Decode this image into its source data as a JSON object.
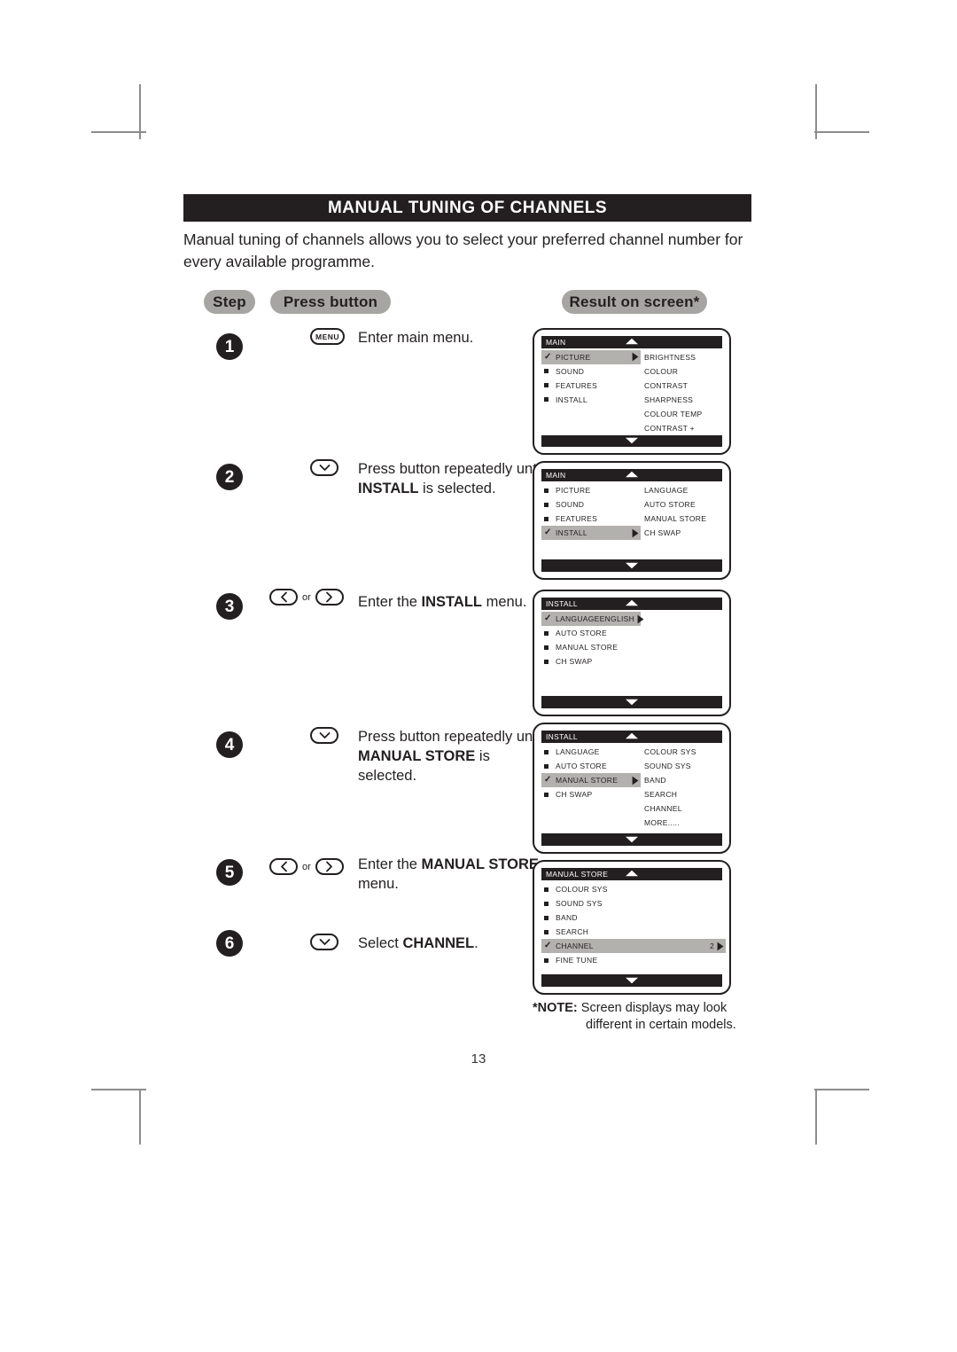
{
  "page": {
    "title": "MANUAL TUNING OF CHANNELS",
    "intro": "Manual tuning of channels allows you to select your preferred channel number for every available programme.",
    "page_number": "13",
    "note_label": "*NOTE:",
    "note_line1": "Screen displays may look",
    "note_line2": "different in certain models.",
    "accent_dark": "#231f20",
    "accent_pill": "#a7a5a2",
    "accent_highlight": "#b3b1ae"
  },
  "columns": {
    "step": "Step",
    "press_button": "Press button",
    "result": "Result on screen*"
  },
  "steps": [
    {
      "number": "1",
      "keys": [
        {
          "type": "menu",
          "label": "MENU"
        }
      ],
      "or_label": "",
      "text_parts": [
        {
          "t": "Enter main menu.",
          "bold": false
        }
      ]
    },
    {
      "number": "2",
      "keys": [
        {
          "type": "down",
          "label": "down-arrow"
        }
      ],
      "or_label": "",
      "text_parts": [
        {
          "t": "Press button repeatedly until ",
          "bold": false
        },
        {
          "t": "INSTALL",
          "bold": true
        },
        {
          "t": " is selected.",
          "bold": false
        }
      ]
    },
    {
      "number": "3",
      "keys": [
        {
          "type": "left",
          "label": "left-arrow"
        },
        {
          "type": "right",
          "label": "right-arrow"
        }
      ],
      "or_label": "or",
      "text_parts": [
        {
          "t": "Enter the ",
          "bold": false
        },
        {
          "t": "INSTALL",
          "bold": true
        },
        {
          "t": " menu.",
          "bold": false
        }
      ]
    },
    {
      "number": "4",
      "keys": [
        {
          "type": "down",
          "label": "down-arrow"
        }
      ],
      "or_label": "",
      "text_parts": [
        {
          "t": "Press button repeatedly until ",
          "bold": false
        },
        {
          "t": "MANUAL STORE",
          "bold": true
        },
        {
          "t": " is selected.",
          "bold": false
        }
      ]
    },
    {
      "number": "5",
      "keys": [
        {
          "type": "left",
          "label": "left-arrow"
        },
        {
          "type": "right",
          "label": "right-arrow"
        }
      ],
      "or_label": "or",
      "text_parts": [
        {
          "t": "Enter the ",
          "bold": false
        },
        {
          "t": "MANUAL STORE",
          "bold": true
        },
        {
          "t": " menu.",
          "bold": false
        }
      ]
    },
    {
      "number": "6",
      "keys": [
        {
          "type": "down",
          "label": "down-arrow"
        }
      ],
      "or_label": "",
      "text_parts": [
        {
          "t": "Select ",
          "bold": false
        },
        {
          "t": "CHANNEL",
          "bold": true
        },
        {
          "t": ".",
          "bold": false
        }
      ]
    }
  ],
  "screens": [
    {
      "header": "MAIN",
      "left_items": [
        {
          "label": "PICTURE",
          "selected": true,
          "arrow": true
        },
        {
          "label": "SOUND",
          "selected": false,
          "arrow": false
        },
        {
          "label": "FEATURES",
          "selected": false,
          "arrow": false
        },
        {
          "label": "INSTALL",
          "selected": false,
          "arrow": false
        }
      ],
      "right_items": [
        "BRIGHTNESS",
        "COLOUR",
        "CONTRAST",
        "SHARPNESS",
        "COLOUR  TEMP",
        "CONTRAST +"
      ]
    },
    {
      "header": "MAIN",
      "left_items": [
        {
          "label": "PICTURE",
          "selected": false,
          "arrow": false
        },
        {
          "label": "SOUND",
          "selected": false,
          "arrow": false
        },
        {
          "label": "FEATURES",
          "selected": false,
          "arrow": false
        },
        {
          "label": "INSTALL",
          "selected": true,
          "arrow": true
        }
      ],
      "right_items": [
        "LANGUAGE",
        "AUTO  STORE",
        "MANUAL  STORE",
        "CH  SWAP"
      ]
    },
    {
      "header": "INSTALL",
      "left_items": [
        {
          "label": "LANGUAGE",
          "selected": true,
          "arrow": true,
          "value": "ENGLISH"
        },
        {
          "label": "AUTO  STORE",
          "selected": false,
          "arrow": false
        },
        {
          "label": "MANUAL  STORE",
          "selected": false,
          "arrow": false
        },
        {
          "label": "CH  SWAP",
          "selected": false,
          "arrow": false
        }
      ],
      "right_items": []
    },
    {
      "header": "INSTALL",
      "left_items": [
        {
          "label": "LANGUAGE",
          "selected": false,
          "arrow": false
        },
        {
          "label": "AUTO  STORE",
          "selected": false,
          "arrow": false
        },
        {
          "label": "MANUAL  STORE",
          "selected": true,
          "arrow": true
        },
        {
          "label": "CH  SWAP",
          "selected": false,
          "arrow": false
        }
      ],
      "right_items": [
        "COLOUR  SYS",
        "SOUND  SYS",
        "BAND",
        "SEARCH",
        "CHANNEL",
        "MORE....."
      ]
    },
    {
      "header": "MANUAL STORE",
      "left_items": [
        {
          "label": "COLOUR  SYS",
          "selected": false,
          "arrow": false
        },
        {
          "label": "SOUND  SYS",
          "selected": false,
          "arrow": false
        },
        {
          "label": "BAND",
          "selected": false,
          "arrow": false
        },
        {
          "label": "SEARCH",
          "selected": false,
          "arrow": false
        },
        {
          "label": "CHANNEL",
          "selected": true,
          "arrow": true,
          "value": "2",
          "wide": true
        },
        {
          "label": "FINE TUNE",
          "selected": false,
          "arrow": false
        }
      ],
      "right_items": []
    }
  ]
}
